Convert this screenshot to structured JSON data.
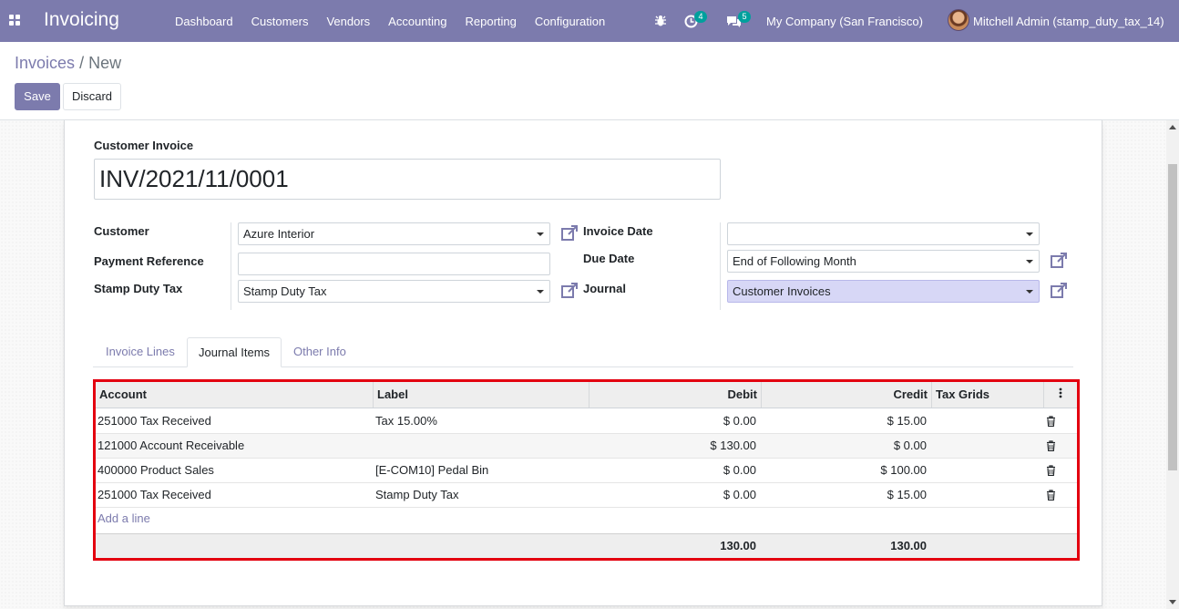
{
  "navbar": {
    "app_title": "Invoicing",
    "menu": [
      "Dashboard",
      "Customers",
      "Vendors",
      "Accounting",
      "Reporting",
      "Configuration"
    ],
    "activity_count": "4",
    "messages_count": "5",
    "company": "My Company (San Francisco)",
    "user": "Mitchell Admin (stamp_duty_tax_14)"
  },
  "breadcrumb": {
    "parent": "Invoices",
    "separator": "/",
    "current": "New"
  },
  "buttons": {
    "save": "Save",
    "discard": "Discard"
  },
  "form": {
    "doc_type": "Customer Invoice",
    "name": "INV/2021/11/0001",
    "left_fields": {
      "customer_label": "Customer",
      "customer_value": "Azure Interior",
      "payment_ref_label": "Payment Reference",
      "payment_ref_value": "",
      "stamp_label": "Stamp Duty Tax",
      "stamp_value": "Stamp Duty Tax"
    },
    "right_fields": {
      "invoice_date_label": "Invoice Date",
      "invoice_date_value": "",
      "due_date_label": "Due Date",
      "due_date_value": "End of Following Month",
      "journal_label": "Journal",
      "journal_value": "Customer Invoices"
    }
  },
  "tabs": [
    "Invoice Lines",
    "Journal Items",
    "Other Info"
  ],
  "active_tab": "Journal Items",
  "journal_table": {
    "columns": [
      "Account",
      "Label",
      "Debit",
      "Credit",
      "Tax Grids"
    ],
    "rows": [
      {
        "account": "251000 Tax Received",
        "label": "Tax 15.00%",
        "debit": "$ 0.00",
        "credit": "$ 15.00"
      },
      {
        "account": "121000 Account Receivable",
        "label": "",
        "debit": "$ 130.00",
        "credit": "$ 0.00"
      },
      {
        "account": "400000 Product Sales",
        "label": "[E-COM10] Pedal Bin",
        "debit": "$ 0.00",
        "credit": "$ 100.00"
      },
      {
        "account": "251000 Tax Received",
        "label": "Stamp Duty Tax",
        "debit": "$ 0.00",
        "credit": "$ 15.00"
      }
    ],
    "add_line": "Add a line",
    "total_debit": "130.00",
    "total_credit": "130.00"
  },
  "colors": {
    "brand": "#7c7bad",
    "highlight_border": "#e3000f",
    "badge": "#00a09d"
  }
}
